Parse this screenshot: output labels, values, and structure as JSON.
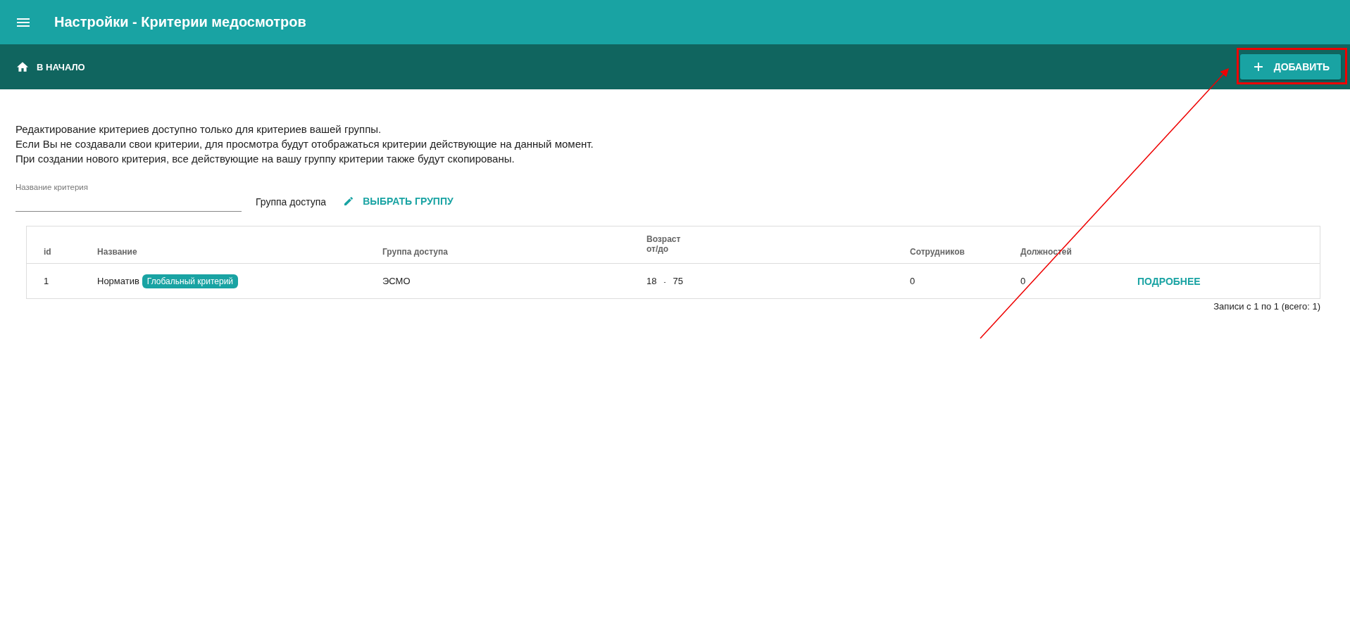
{
  "app_bar": {
    "title": "Настройки - Критерии медосмотров"
  },
  "toolbar": {
    "home_link": "В НАЧАЛО",
    "add_button": "ДОБАВИТЬ"
  },
  "notice": [
    "Редактирование критериев доступно только для критериев вашей группы.",
    "Если Вы не создавали свои критерии, для просмотра будут отображаться критерии действующие на данный момент.",
    "При создании нового критерия, все действующие на вашу группу критерии также будут скопированы."
  ],
  "filters": {
    "name_field": {
      "label": "Название критерия"
    },
    "group_label": "Группа доступа",
    "group_button": "ВЫБРАТЬ ГРУППУ"
  },
  "table": {
    "columns": [
      "id",
      [
        "Название"
      ],
      [
        "Группа доступа"
      ],
      [
        "Возраст",
        "от/до"
      ],
      [
        "Сотрудников"
      ],
      [
        "Должностей"
      ]
    ],
    "rows": [
      {
        "id": "1",
        "name": "Норматив",
        "badge": "Глобальный критерий",
        "group": "ЭСМО",
        "age_from": "18",
        "age_separator": "-",
        "age_to": "75",
        "employees": "0",
        "positions": "0",
        "action": "ПОДРОБНЕЕ"
      }
    ]
  },
  "pagination": "Записи с 1 по 1 (всего: 1)",
  "annotation": {
    "highlight": true,
    "arrow": true
  }
}
